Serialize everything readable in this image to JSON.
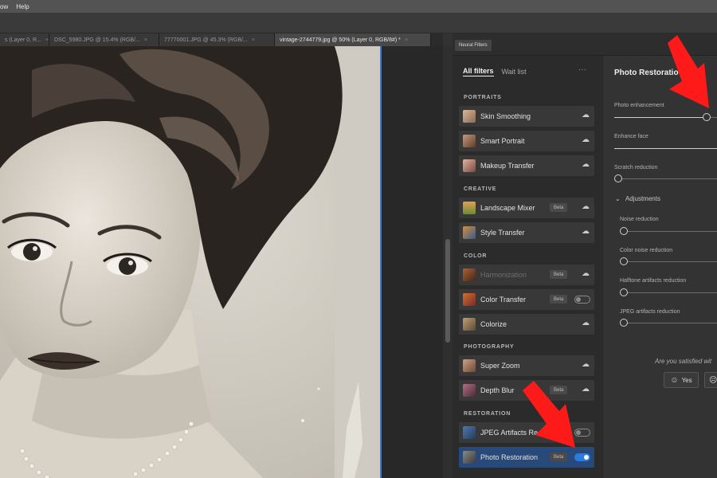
{
  "menubar": {
    "items": [
      "ow",
      "Help"
    ]
  },
  "tabs": [
    {
      "label": "s (Layer 0, R..."
    },
    {
      "label": "DSC_5980.JPG @ 15.4% (RGB/..."
    },
    {
      "label": "77770001.JPG @ 45.3% (RGB/..."
    },
    {
      "label": "vintage-2744779.jpg @ 50% (Layer 0, RGB/8#) *"
    }
  ],
  "tab_close": "×",
  "neural_filters": {
    "panel_tab": "Neural Filters",
    "list_tabs": {
      "all": "All filters",
      "wait": "Wait list"
    },
    "more": "···",
    "categories": {
      "portraits": "PORTRAITS",
      "creative": "CREATIVE",
      "color": "COLOR",
      "photography": "PHOTOGRAPHY",
      "restoration": "RESTORATION"
    },
    "items": {
      "skin_smoothing": "Skin Smoothing",
      "smart_portrait": "Smart Portrait",
      "makeup_transfer": "Makeup Transfer",
      "landscape_mixer": "Landscape Mixer",
      "style_transfer": "Style Transfer",
      "harmonization": "Harmonization",
      "color_transfer": "Color Transfer",
      "colorize": "Colorize",
      "super_zoom": "Super Zoom",
      "depth_blur": "Depth Blur",
      "jpeg_artifacts": "JPEG Artifacts Re",
      "photo_restoration": "Photo Restoration"
    },
    "beta": "Beta",
    "cloud": "☁",
    "toggles": {
      "color_transfer": false,
      "jpeg_artifacts": false,
      "photo_restoration": true
    }
  },
  "settings": {
    "title": "Photo Restoratio",
    "photo_enhancement": "Photo enhancement",
    "enhance_face": "Enhance face",
    "scratch_reduction": "Scratch reduction",
    "adjustments": "Adjustments",
    "adjust_chevron": "⌄",
    "noise_reduction": "Noise reduction",
    "color_noise_reduction": "Color noise reduction",
    "halftone_reduction": "Halftone artifacts reduction",
    "jpeg_reduction": "JPEG artifacts reduction",
    "satisfied": "Are you satisfied wit",
    "yes": "Yes",
    "yes_icon": "☺",
    "no_icon": "☹",
    "slider_values": {
      "photo_enhancement": 0.9,
      "enhance_face": 1.0,
      "scratch_reduction": 0.0,
      "noise_reduction": 0.0,
      "color_noise_reduction": 0.0,
      "halftone_reduction": 0.0,
      "jpeg_reduction": 0.0
    }
  },
  "colors": {
    "accent": "#2d7ae0",
    "selected_row": "#274a7a",
    "annotation_arrow": "#ff1a1a"
  }
}
